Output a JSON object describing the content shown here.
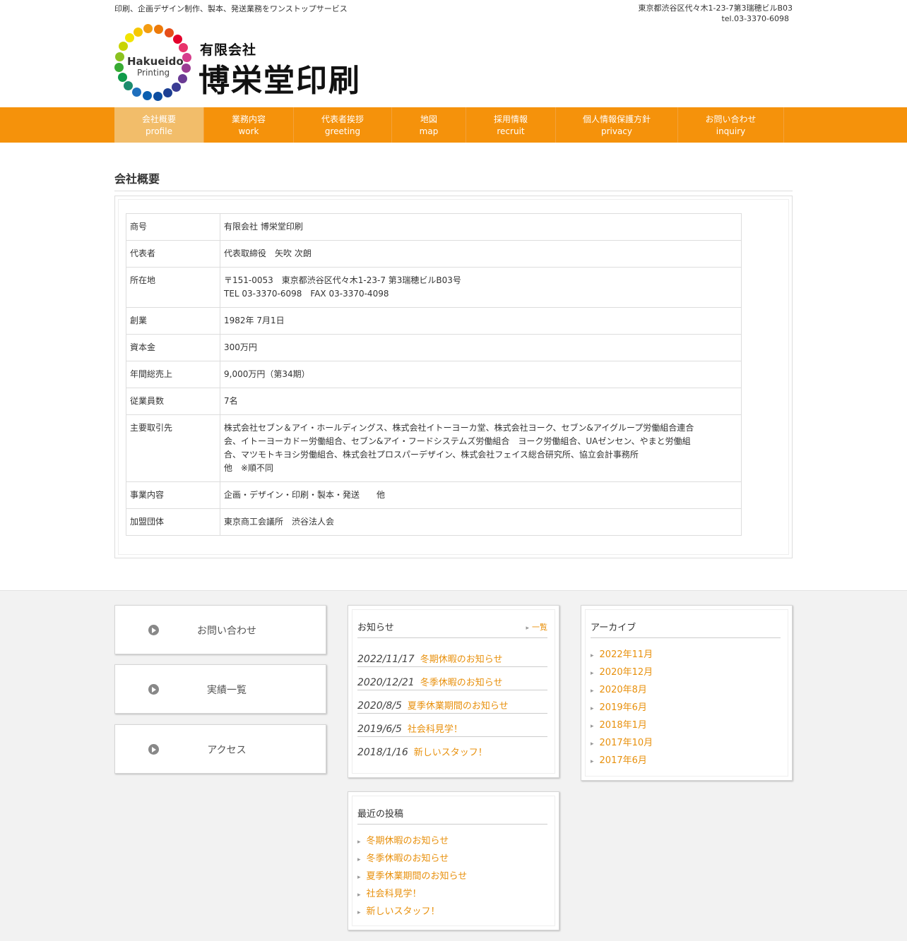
{
  "header": {
    "tagline": "印刷、企画デザイン制作、製本、発送業務をワンストップサービス",
    "address": "東京都渋谷区代々木1-23-7第3瑞穂ビルB03",
    "tel": "tel.03-3370-6098",
    "logo_ring_text_1": "Hakueido",
    "logo_ring_text_2": "Printing",
    "logo_sub": "有限会社",
    "logo_main": "博栄堂印刷"
  },
  "colors": {
    "accent": "#f5920b",
    "nav_active": "#f2bd6a",
    "link": "#e8900c"
  },
  "nav": [
    {
      "ja": "会社概要",
      "en": "profile"
    },
    {
      "ja": "業務内容",
      "en": "work"
    },
    {
      "ja": "代表者挨拶",
      "en": "greeting"
    },
    {
      "ja": "地図",
      "en": "map"
    },
    {
      "ja": "採用情報",
      "en": "recruit"
    },
    {
      "ja": "個人情報保護方針",
      "en": "privacy"
    },
    {
      "ja": "お問い合わせ",
      "en": "inquiry"
    }
  ],
  "page_title": "会社概要",
  "company": [
    {
      "label": "商号",
      "lines": [
        "有限会社 博栄堂印刷"
      ]
    },
    {
      "label": "代表者",
      "lines": [
        "代表取締役　矢吹 次朗"
      ]
    },
    {
      "label": "所在地",
      "lines": [
        "〒151-0053　東京都渋谷区代々木1-23-7 第3瑞穂ビルB03号",
        "TEL 03-3370-6098　FAX 03-3370-4098"
      ]
    },
    {
      "label": "創業",
      "lines": [
        "1982年 7月1日"
      ]
    },
    {
      "label": "資本金",
      "lines": [
        "300万円"
      ]
    },
    {
      "label": "年間総売上",
      "lines": [
        "9,000万円（第34期）"
      ]
    },
    {
      "label": "従業員数",
      "lines": [
        "7名"
      ]
    },
    {
      "label": "主要取引先",
      "lines": [
        "株式会社セブン＆アイ・ホールディングス、株式会社イトーヨーカ堂、株式会社ヨーク、セブン&アイグループ労働組合連合",
        "会、イトーヨーカドー労働組合、セブン&アイ・フードシステムズ労働組合　ヨーク労働組合、UAゼンセン、やまと労働組",
        "合、マツモトキヨシ労働組合、株式会社プロスパーデザイン、株式会社フェイス総合研究所、協立会計事務所",
        "他　※順不同"
      ]
    },
    {
      "label": "事業内容",
      "lines": [
        "企画・デザイン・印刷・製本・発送　　他"
      ]
    },
    {
      "label": "加盟団体",
      "lines": [
        "東京商工会議所　渋谷法人会"
      ]
    }
  ],
  "side_buttons": [
    {
      "label": "お問い合わせ",
      "icon": "play-icon"
    },
    {
      "label": "実績一覧",
      "icon": "play-icon"
    },
    {
      "label": "アクセス",
      "icon": "play-icon"
    }
  ],
  "news": {
    "title": "お知らせ",
    "more": "一覧",
    "items": [
      {
        "date": "2022/11/17",
        "title": "冬期休暇のお知らせ"
      },
      {
        "date": "2020/12/21",
        "title": "冬季休暇のお知らせ"
      },
      {
        "date": "2020/8/5",
        "title": "夏季休業期間のお知らせ"
      },
      {
        "date": "2019/6/5",
        "title": "社会科見学！"
      },
      {
        "date": "2018/1/16",
        "title": "新しいスタッフ！"
      }
    ]
  },
  "recent": {
    "title": "最近の投稿",
    "items": [
      "冬期休暇のお知らせ",
      "冬季休暇のお知らせ",
      "夏季休業期間のお知らせ",
      "社会科見学！",
      "新しいスタッフ！"
    ]
  },
  "archive": {
    "title": "アーカイブ",
    "items": [
      "2022年11月",
      "2020年12月",
      "2020年8月",
      "2019年6月",
      "2018年1月",
      "2017年10月",
      "2017年6月"
    ]
  }
}
